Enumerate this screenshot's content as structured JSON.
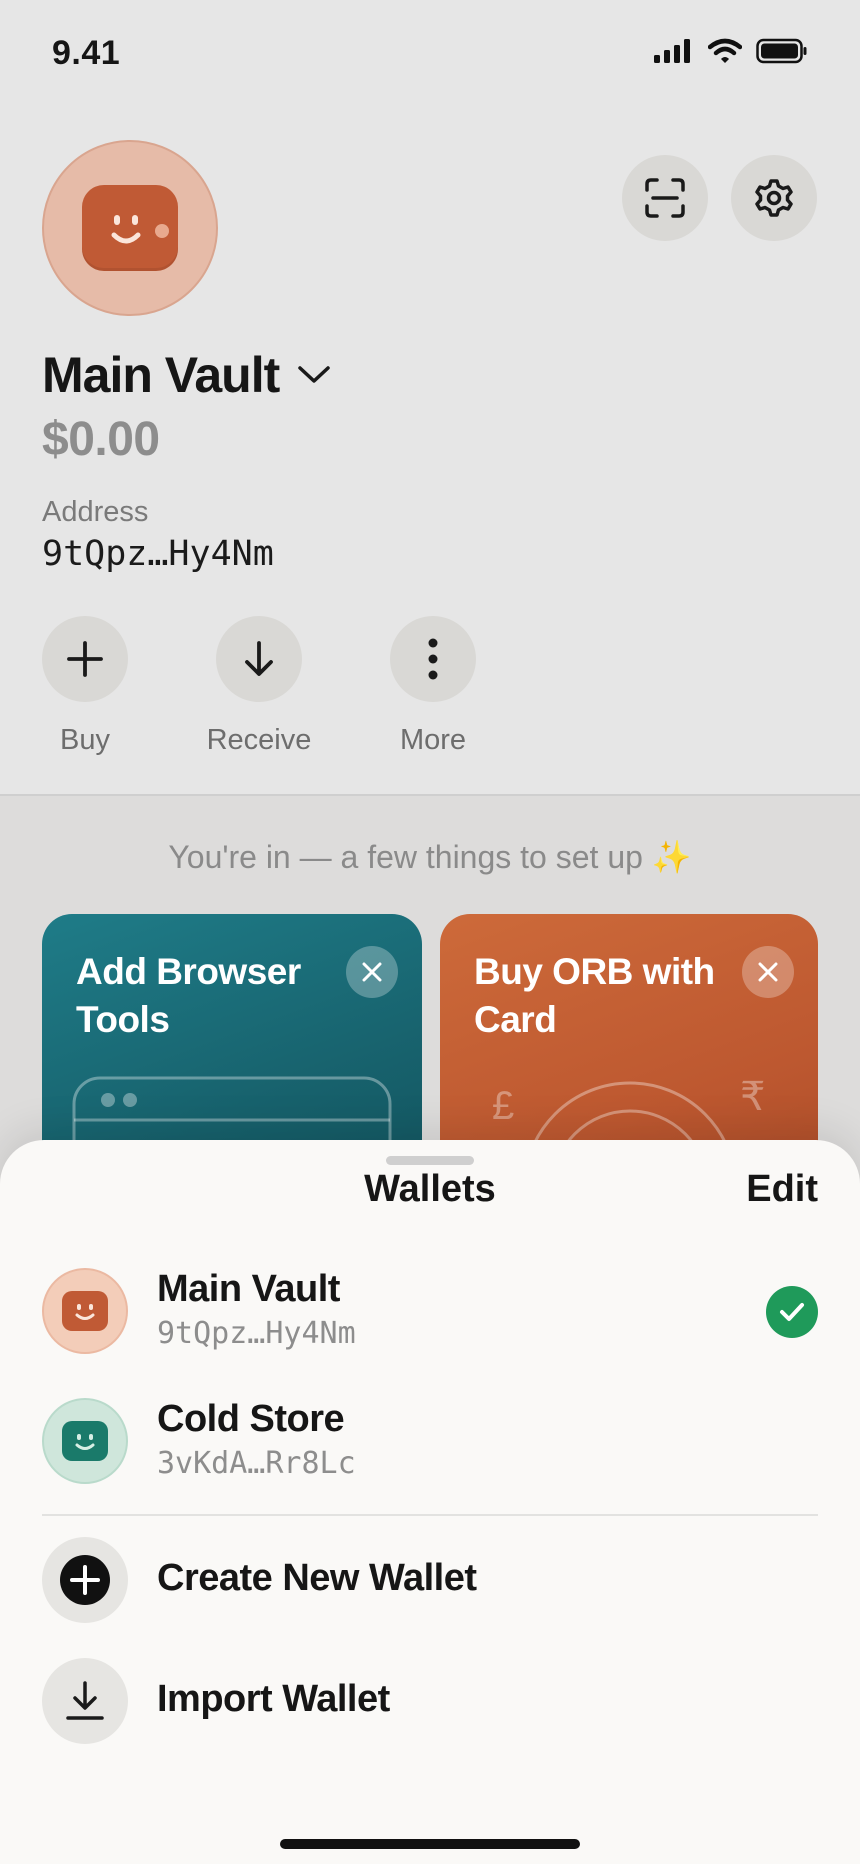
{
  "status_bar": {
    "time": "9.41"
  },
  "header": {
    "wallet_name": "Main Vault",
    "balance": "$0.00",
    "address_label": "Address",
    "address": "9tQpz…Hy4Nm"
  },
  "actions": [
    {
      "label": "Buy",
      "icon": "plus-icon"
    },
    {
      "label": "Receive",
      "icon": "arrow-down-icon"
    },
    {
      "label": "More",
      "icon": "more-vertical-icon"
    }
  ],
  "setup": {
    "text": "You're in — a few things to set up ✨",
    "cards": [
      {
        "title_line1": "Add Browser",
        "title_line2": "Tools",
        "color": "#1a6d78"
      },
      {
        "title_line1": "Buy ORB with",
        "title_line2": "Card",
        "color": "#c15c32",
        "currency_symbols": [
          "£",
          "₹"
        ]
      }
    ]
  },
  "sheet": {
    "title": "Wallets",
    "edit_label": "Edit",
    "wallets": [
      {
        "name": "Main Vault",
        "address": "9tQpz…Hy4Nm",
        "selected": true,
        "color": "#c05a35",
        "bg": "#f3cdb9"
      },
      {
        "name": "Cold Store",
        "address": "3vKdA…Rr8Lc",
        "selected": false,
        "color": "#1a7a6a",
        "bg": "#cfe6db"
      }
    ],
    "actions": [
      {
        "label": "Create New Wallet",
        "icon": "plus-circle-icon"
      },
      {
        "label": "Import Wallet",
        "icon": "download-icon"
      }
    ]
  },
  "colors": {
    "accent_green": "#1f9a5a",
    "brand_orange": "#c05a35",
    "brand_teal": "#1a6d78"
  }
}
